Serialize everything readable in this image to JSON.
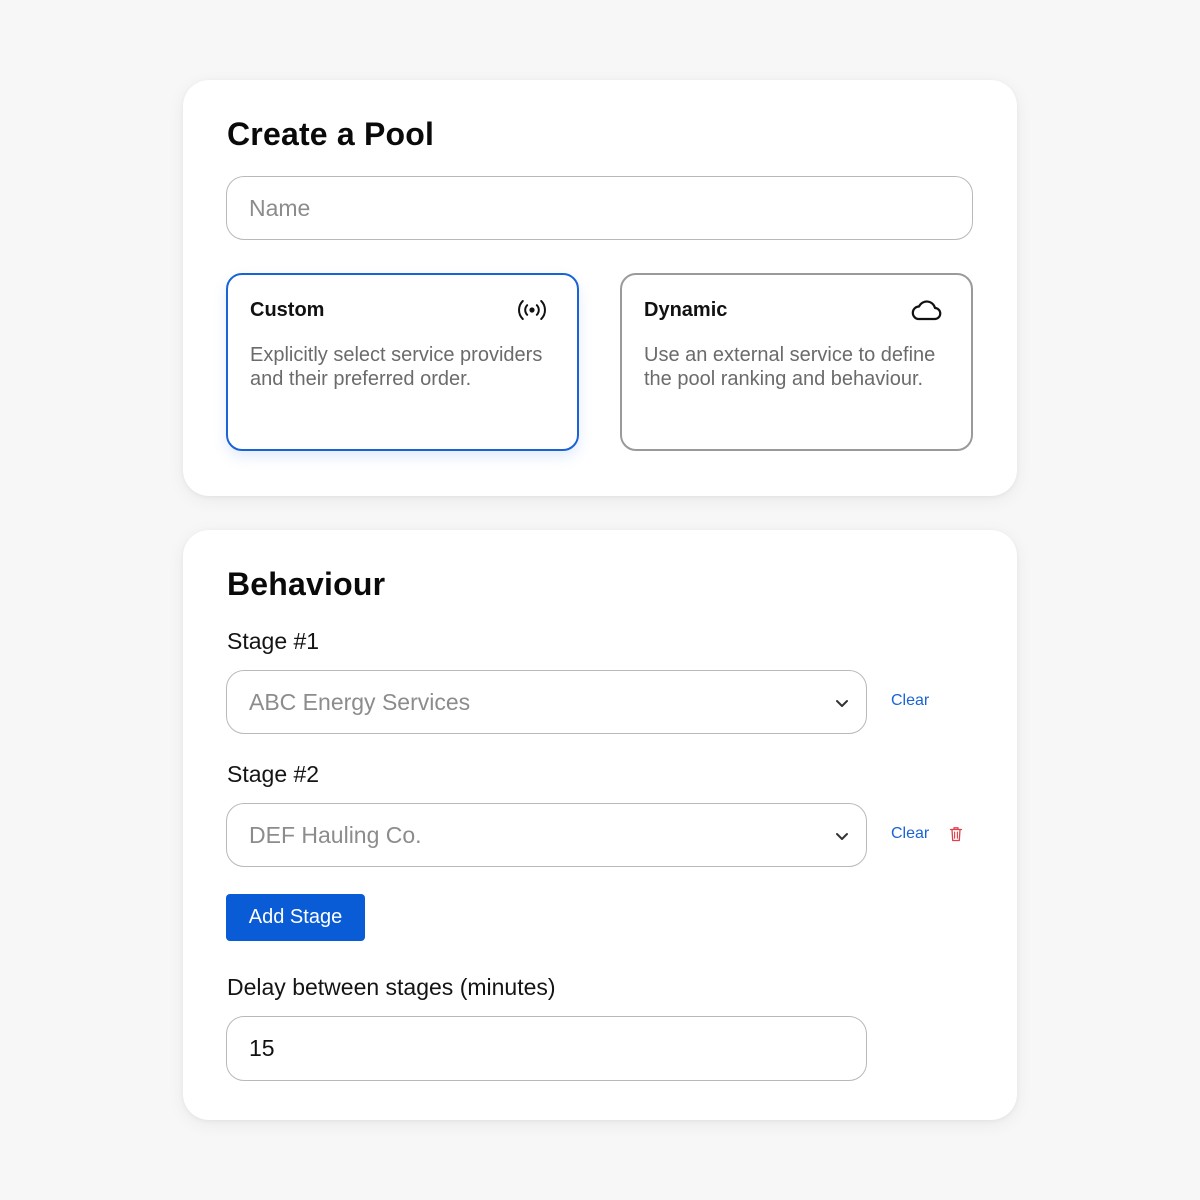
{
  "create_pool": {
    "title": "Create a Pool",
    "name_placeholder": "Name",
    "options": [
      {
        "title": "Custom",
        "icon": "broadcast-icon",
        "description": "Explicitly select service providers and their preferred order.",
        "selected": true
      },
      {
        "title": "Dynamic",
        "icon": "cloud-icon",
        "description": "Use an external service to define the pool ranking and behaviour.",
        "selected": false
      }
    ]
  },
  "behaviour": {
    "title": "Behaviour",
    "stages": [
      {
        "label": "Stage #1",
        "value": "ABC Energy Services",
        "clear_label": "Clear",
        "deletable": false
      },
      {
        "label": "Stage #2",
        "value": "DEF Hauling Co.",
        "clear_label": "Clear",
        "deletable": true
      }
    ],
    "add_stage_label": "Add Stage",
    "delay_label": "Delay between stages (minutes)",
    "delay_value": "15"
  },
  "colors": {
    "accent": "#0a5cd6",
    "selected_border": "#1a63d6",
    "delete": "#e0404a",
    "page_bg": "#f7f7f7"
  }
}
